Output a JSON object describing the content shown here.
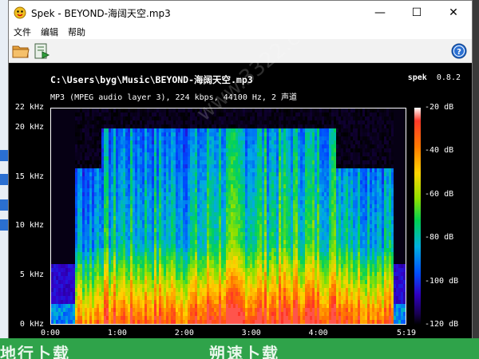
{
  "window": {
    "title": "Spek - BEYOND-海阔天空.mp3",
    "controls": {
      "minimize": "—",
      "maximize": "☐",
      "close": "✕"
    }
  },
  "menu": {
    "items": [
      "文件",
      "编辑",
      "帮助"
    ]
  },
  "toolbar": {
    "icons": [
      "open-folder-icon",
      "save-icon",
      "help-icon"
    ]
  },
  "spek": {
    "file_path": "C:\\Users\\byg\\Music\\BEYOND-海阔天空.mp3",
    "file_info": "MP3 (MPEG audio layer 3), 224 kbps, 44100 Hz, 2 声道",
    "app_name": "spek",
    "app_version": "0.8.2",
    "watermark": "www.3322.cc"
  },
  "chart_data": {
    "type": "heatmap",
    "y_ticks": [
      "22 kHz",
      "20 kHz",
      "15 kHz",
      "10 kHz",
      "5 kHz",
      "0 kHz"
    ],
    "y_values": [
      22,
      20,
      15,
      10,
      5,
      0
    ],
    "ylim": [
      0,
      22
    ],
    "x_ticks": [
      "0:00",
      "1:00",
      "2:00",
      "3:00",
      "4:00",
      "5:19"
    ],
    "x_values": [
      0,
      60,
      120,
      180,
      240,
      319
    ],
    "xlim": [
      0,
      319
    ],
    "colorbar_ticks": [
      "-20 dB",
      "-40 dB",
      "-60 dB",
      "-80 dB",
      "-100 dB",
      "-120 dB"
    ],
    "colorbar_values": [
      -20,
      -40,
      -60,
      -80,
      -100,
      -120
    ],
    "clim": [
      -120,
      -20
    ]
  },
  "background": {
    "bottom_text_left": "地行卜载",
    "bottom_text_right": "朔速卜载"
  }
}
